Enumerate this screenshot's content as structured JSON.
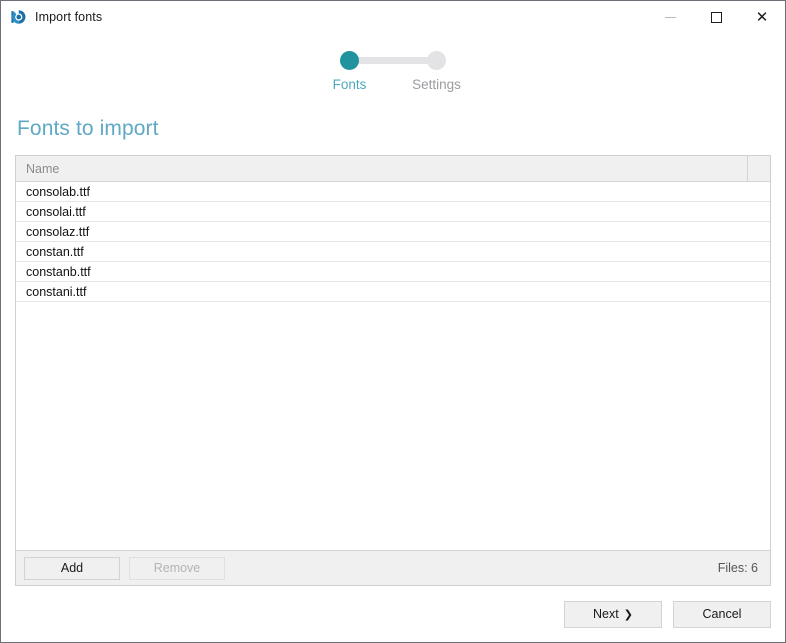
{
  "window": {
    "title": "Import fonts",
    "app_icon": "app-logo-icon",
    "controls": {
      "minimize_label": "Minimize",
      "maximize_label": "Maximize",
      "close_label": "Close"
    }
  },
  "stepper": {
    "steps": [
      {
        "label": "Fonts",
        "active": true
      },
      {
        "label": "Settings",
        "active": false
      }
    ],
    "active_color": "#21939f",
    "inactive_color": "#e3e3e5",
    "active_label_color": "#4fa8bd",
    "inactive_label_color": "#9c9ca0"
  },
  "main": {
    "heading": "Fonts to import",
    "heading_color": "#5fa9c4",
    "table": {
      "columns": [
        "Name",
        ""
      ],
      "rows": [
        {
          "name": "consolab.ttf"
        },
        {
          "name": "consolai.ttf"
        },
        {
          "name": "consolaz.ttf"
        },
        {
          "name": "constan.ttf"
        },
        {
          "name": "constanb.ttf"
        },
        {
          "name": "constani.ttf"
        }
      ]
    },
    "toolbar": {
      "add_label": "Add",
      "remove_label": "Remove",
      "remove_disabled": true,
      "file_count_label": "Files: 6"
    }
  },
  "footer": {
    "next_label": "Next",
    "next_chevron": "❯",
    "cancel_label": "Cancel"
  }
}
